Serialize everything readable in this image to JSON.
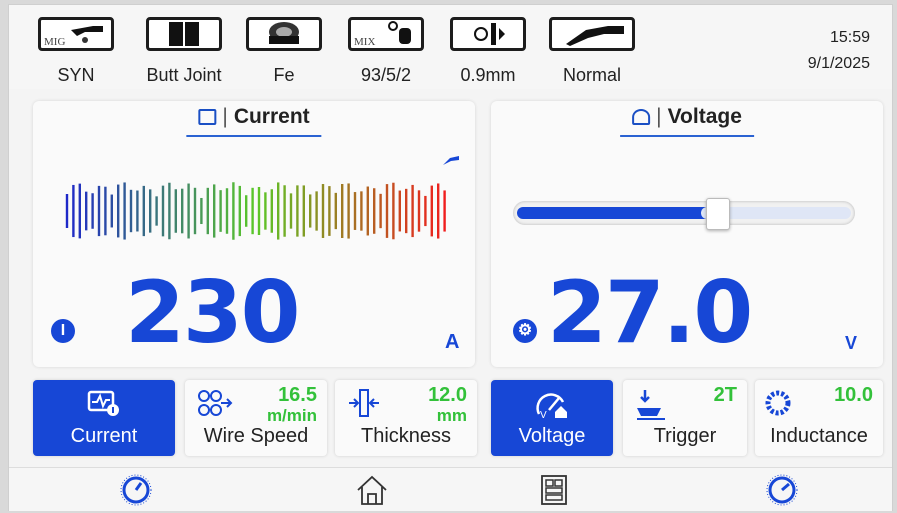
{
  "top_bar": {
    "items": [
      {
        "label": "SYN",
        "icon": "mig-torch-icon",
        "tag": "MIG"
      },
      {
        "label": "Butt Joint",
        "icon": "butt-joint-icon"
      },
      {
        "label": "Fe",
        "icon": "wire-spool-icon"
      },
      {
        "label": "93/5/2",
        "icon": "gas-mix-icon",
        "tag": "MIX"
      },
      {
        "label": "0.9mm",
        "icon": "wire-diameter-icon"
      },
      {
        "label": "Normal",
        "icon": "torch-icon"
      }
    ],
    "time": "15:59",
    "date": "9/1/2025"
  },
  "current_panel": {
    "title": "Current",
    "value": "230",
    "unit": "A",
    "badge": "I"
  },
  "voltage_panel": {
    "title": "Voltage",
    "value": "27.0",
    "unit": "V",
    "slider_level": 0.59
  },
  "tiles": [
    {
      "label": "Current",
      "icon": "current-monitor-icon",
      "active": true
    },
    {
      "label": "Wire Speed",
      "icon": "wire-feed-rollers-icon",
      "value": "16.5",
      "unit": "m/min"
    },
    {
      "label": "Thickness",
      "icon": "thickness-icon",
      "value": "12.0",
      "unit": "mm"
    },
    {
      "label": "Voltage",
      "icon": "voltage-gauge-icon",
      "active": true
    },
    {
      "label": "Trigger",
      "icon": "trigger-icon",
      "value": "2T"
    },
    {
      "label": "Inductance",
      "icon": "inductance-coil-icon",
      "value": "10.0"
    }
  ],
  "nav": {
    "items": [
      "left-dial-icon",
      "home-icon",
      "menu-grid-icon",
      "right-dial-icon"
    ]
  },
  "colors": {
    "accent": "#1747d6",
    "value_green": "#33c13a"
  }
}
